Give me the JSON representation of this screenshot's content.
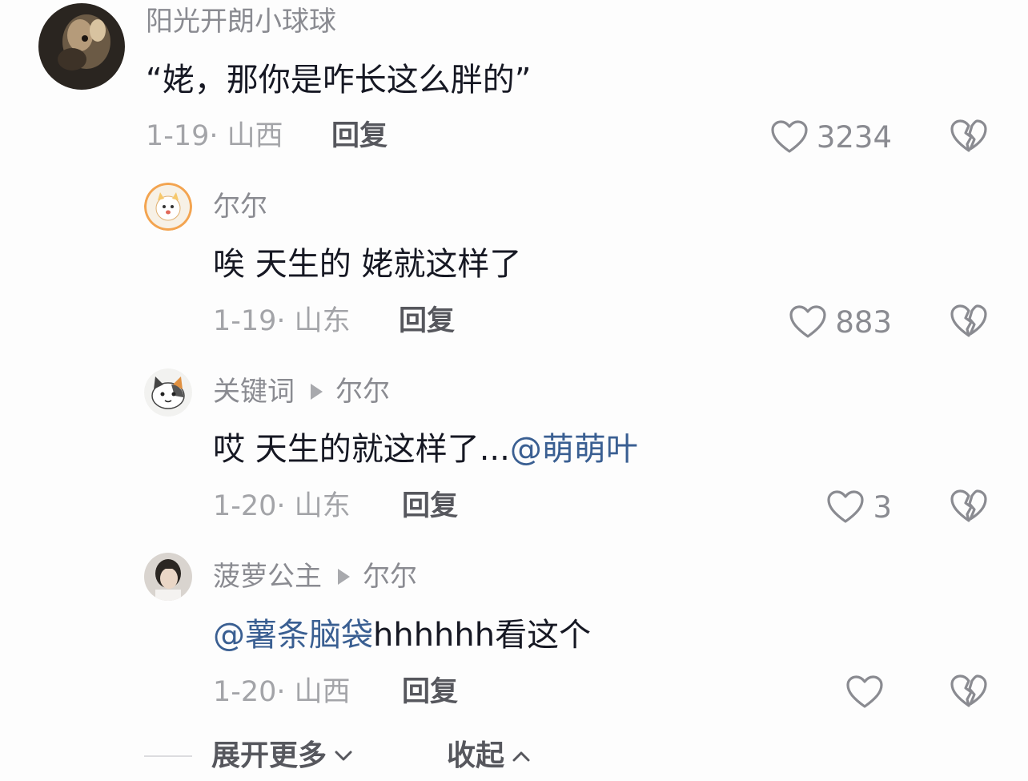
{
  "comments": [
    {
      "author": "阳光开朗小球球",
      "text": "“姥，那你是咋长这么胖的”",
      "meta": "1-19· 山西",
      "reply_label": "回复",
      "likes": "3234"
    },
    {
      "author": "尔尔",
      "text": "唉 天生的 姥就这样了",
      "meta": "1-19· 山东",
      "reply_label": "回复",
      "likes": "883"
    },
    {
      "author": "关键词",
      "reply_to": "尔尔",
      "text": "哎 天生的就这样了...",
      "mention": "@萌萌叶",
      "meta": "1-20· 山东",
      "reply_label": "回复",
      "likes": "3"
    },
    {
      "author": "菠萝公主",
      "reply_to": "尔尔",
      "mention": "@薯条脑袋",
      "text": "hhhhhh看这个",
      "meta": "1-20· 山西",
      "reply_label": "回复",
      "likes": ""
    }
  ],
  "footer": {
    "expand_label": "展开更多",
    "collapse_label": "收起"
  },
  "icons": {
    "like": "heart-outline-icon",
    "dislike": "broken-heart-icon",
    "reply_arrow": "triangle-right-icon",
    "expand": "chevron-down-icon",
    "collapse": "chevron-up-icon"
  },
  "colors": {
    "mention": "#3a5f92",
    "username": "#8a8b91",
    "meta": "#a3a4a8",
    "body": "#161823"
  }
}
